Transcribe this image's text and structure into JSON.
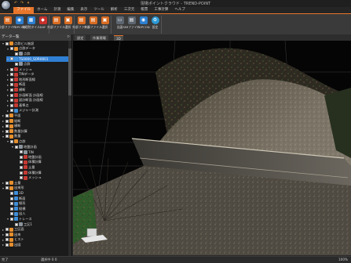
{
  "app": {
    "title": "現場ポイントクラウド - TREND-POINT"
  },
  "quick_access": [
    "↶",
    "↷",
    "▾"
  ],
  "menu": {
    "tabs": [
      "ファイル",
      "ホーム",
      "計測",
      "編集",
      "表示",
      "ツール",
      "解析",
      "三次元",
      "帳票",
      "工事計算",
      "ヘルプ"
    ],
    "active_index": 0
  },
  "ribbon": {
    "groups": [
      {
        "buttons": [
          {
            "label": "外部ファイル",
            "icon": "folder-open-icon"
          },
          {
            "label": "TOPCON",
            "icon": "scanner-icon"
          },
          {
            "label": "地理院タイル",
            "icon": "map-tile-icon"
          },
          {
            "label": "DXF",
            "icon": "dxf-icon"
          }
        ]
      },
      {
        "buttons": [
          {
            "label": "外部ファイル",
            "icon": "folder-open-icon"
          },
          {
            "label": "選択",
            "icon": "select-icon"
          }
        ]
      },
      {
        "buttons": [
          {
            "label": "外部ファイル",
            "icon": "folder-open-icon"
          },
          {
            "label": "外部ファイル",
            "icon": "folder-open-icon"
          },
          {
            "label": "選択",
            "icon": "select-icon"
          }
        ]
      },
      {
        "buttons": [
          {
            "label": "出図",
            "icon": "print-icon"
          },
          {
            "label": "SIMファイル",
            "icon": "sim-file-icon"
          },
          {
            "label": "TOPCON",
            "icon": "scanner-icon"
          },
          {
            "label": "設定",
            "icon": "gear-icon"
          }
        ]
      }
    ]
  },
  "panel": {
    "title": "データ一覧",
    "pin": "ᐅ",
    "tree": [
      {
        "depth": 0,
        "expand": "▾",
        "icon": "f",
        "label": "点群ビル施設"
      },
      {
        "depth": 1,
        "expand": "▾",
        "icon": "f",
        "label": "点群データ"
      },
      {
        "depth": 2,
        "expand": "",
        "icon": "g",
        "label": "点群"
      },
      {
        "depth": 1,
        "expand": "▾",
        "icon": "b",
        "label": "TS0000_SOR0001",
        "selected": true
      },
      {
        "depth": 2,
        "expand": "",
        "icon": "g",
        "label": "点群"
      },
      {
        "depth": 1,
        "expand": "▸",
        "icon": "r",
        "label": "メッシュ"
      },
      {
        "depth": 1,
        "expand": "▸",
        "icon": "r",
        "label": "TINデータ"
      },
      {
        "depth": 1,
        "expand": "▸",
        "icon": "r",
        "label": "地形断面線"
      },
      {
        "depth": 1,
        "expand": "▸",
        "icon": "r",
        "label": "断面"
      },
      {
        "depth": 1,
        "expand": "▸",
        "icon": "r",
        "label": "横断"
      },
      {
        "depth": 1,
        "expand": "▸",
        "icon": "r",
        "label": "計画断面 計画線"
      },
      {
        "depth": 1,
        "expand": "▸",
        "icon": "r",
        "label": "設計断面 計画線"
      },
      {
        "depth": 1,
        "expand": "▸",
        "icon": "r",
        "label": "基準点"
      },
      {
        "depth": 1,
        "expand": "▸",
        "icon": "b",
        "label": "メジャー計測"
      },
      {
        "depth": 0,
        "expand": "▸",
        "icon": "f",
        "label": "平面"
      },
      {
        "depth": 0,
        "expand": "▸",
        "icon": "f",
        "label": "縦断"
      },
      {
        "depth": 0,
        "expand": "▸",
        "icon": "f",
        "label": "横断"
      },
      {
        "depth": 0,
        "expand": "▸",
        "icon": "f",
        "label": "数量計算"
      },
      {
        "depth": 0,
        "expand": "▾",
        "icon": "f",
        "label": "数量"
      },
      {
        "depth": 1,
        "expand": "▾",
        "icon": "f",
        "label": "点群"
      },
      {
        "depth": 2,
        "expand": "▾",
        "icon": "g",
        "label": "地盤計画"
      },
      {
        "depth": 3,
        "expand": "",
        "icon": "g",
        "label": "TIN"
      },
      {
        "depth": 3,
        "expand": "",
        "icon": "r",
        "label": "地盤計画"
      },
      {
        "depth": 3,
        "expand": "",
        "icon": "r",
        "label": "体積計算"
      },
      {
        "depth": 3,
        "expand": "",
        "icon": "r",
        "label": "土量"
      },
      {
        "depth": 3,
        "expand": "",
        "icon": "r",
        "label": "体積計算"
      },
      {
        "depth": 3,
        "expand": "",
        "icon": "r",
        "label": "メッシュ"
      },
      {
        "depth": 0,
        "expand": "▸",
        "icon": "f",
        "label": "土量"
      },
      {
        "depth": 0,
        "expand": "▾",
        "icon": "f",
        "label": "出来形"
      },
      {
        "depth": 1,
        "expand": "",
        "icon": "b",
        "label": "3D"
      },
      {
        "depth": 1,
        "expand": "",
        "icon": "b",
        "label": "断面"
      },
      {
        "depth": 1,
        "expand": "",
        "icon": "b",
        "label": "線形"
      },
      {
        "depth": 1,
        "expand": "",
        "icon": "b",
        "label": "縦横"
      },
      {
        "depth": 1,
        "expand": "",
        "icon": "b",
        "label": "出入"
      },
      {
        "depth": 1,
        "expand": "▾",
        "icon": "b",
        "label": "トレース"
      },
      {
        "depth": 2,
        "expand": "",
        "icon": "g",
        "label": "工区1"
      },
      {
        "depth": 0,
        "expand": "▸",
        "icon": "f",
        "label": "工区面"
      },
      {
        "depth": 0,
        "expand": "▸",
        "icon": "f",
        "label": "出来"
      },
      {
        "depth": 0,
        "expand": "▸",
        "icon": "f",
        "label": "ヒスト"
      },
      {
        "depth": 0,
        "expand": "▸",
        "icon": "f",
        "label": "出図"
      }
    ]
  },
  "doc_tabs": [
    "設定",
    "作業現場",
    "3D"
  ],
  "doc_tabs_active": 2,
  "status": {
    "left": "完了",
    "middle": "選択中  0  0",
    "right": "100%"
  },
  "colors": {
    "accent": "#e8762b",
    "selection": "#2f7fd4"
  }
}
